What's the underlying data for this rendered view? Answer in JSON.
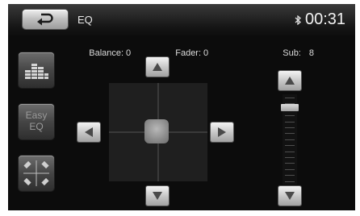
{
  "header": {
    "title": "EQ",
    "clock": "00:31",
    "back_icon": "back-arrow-icon",
    "bluetooth_icon": "bluetooth-icon"
  },
  "info": {
    "balance_label": "Balance:",
    "balance_value": "0",
    "fader_label": "Fader:",
    "fader_value": "0",
    "sub_label": "Sub:",
    "sub_value": "8"
  },
  "sidebar": {
    "items": [
      {
        "name": "equalizer-preset-button",
        "icon": "equalizer-bars-icon"
      },
      {
        "name": "easy-eq-button",
        "label_line1": "Easy",
        "label_line2": "EQ"
      },
      {
        "name": "balance-fader-button",
        "icon": "speaker-balance-icon"
      }
    ]
  },
  "subwoofer": {
    "level": 8,
    "max": 14
  },
  "colors": {
    "background": "#0c0c0c",
    "button_light": "#e6e6e6",
    "text": "#dcdcdc"
  }
}
